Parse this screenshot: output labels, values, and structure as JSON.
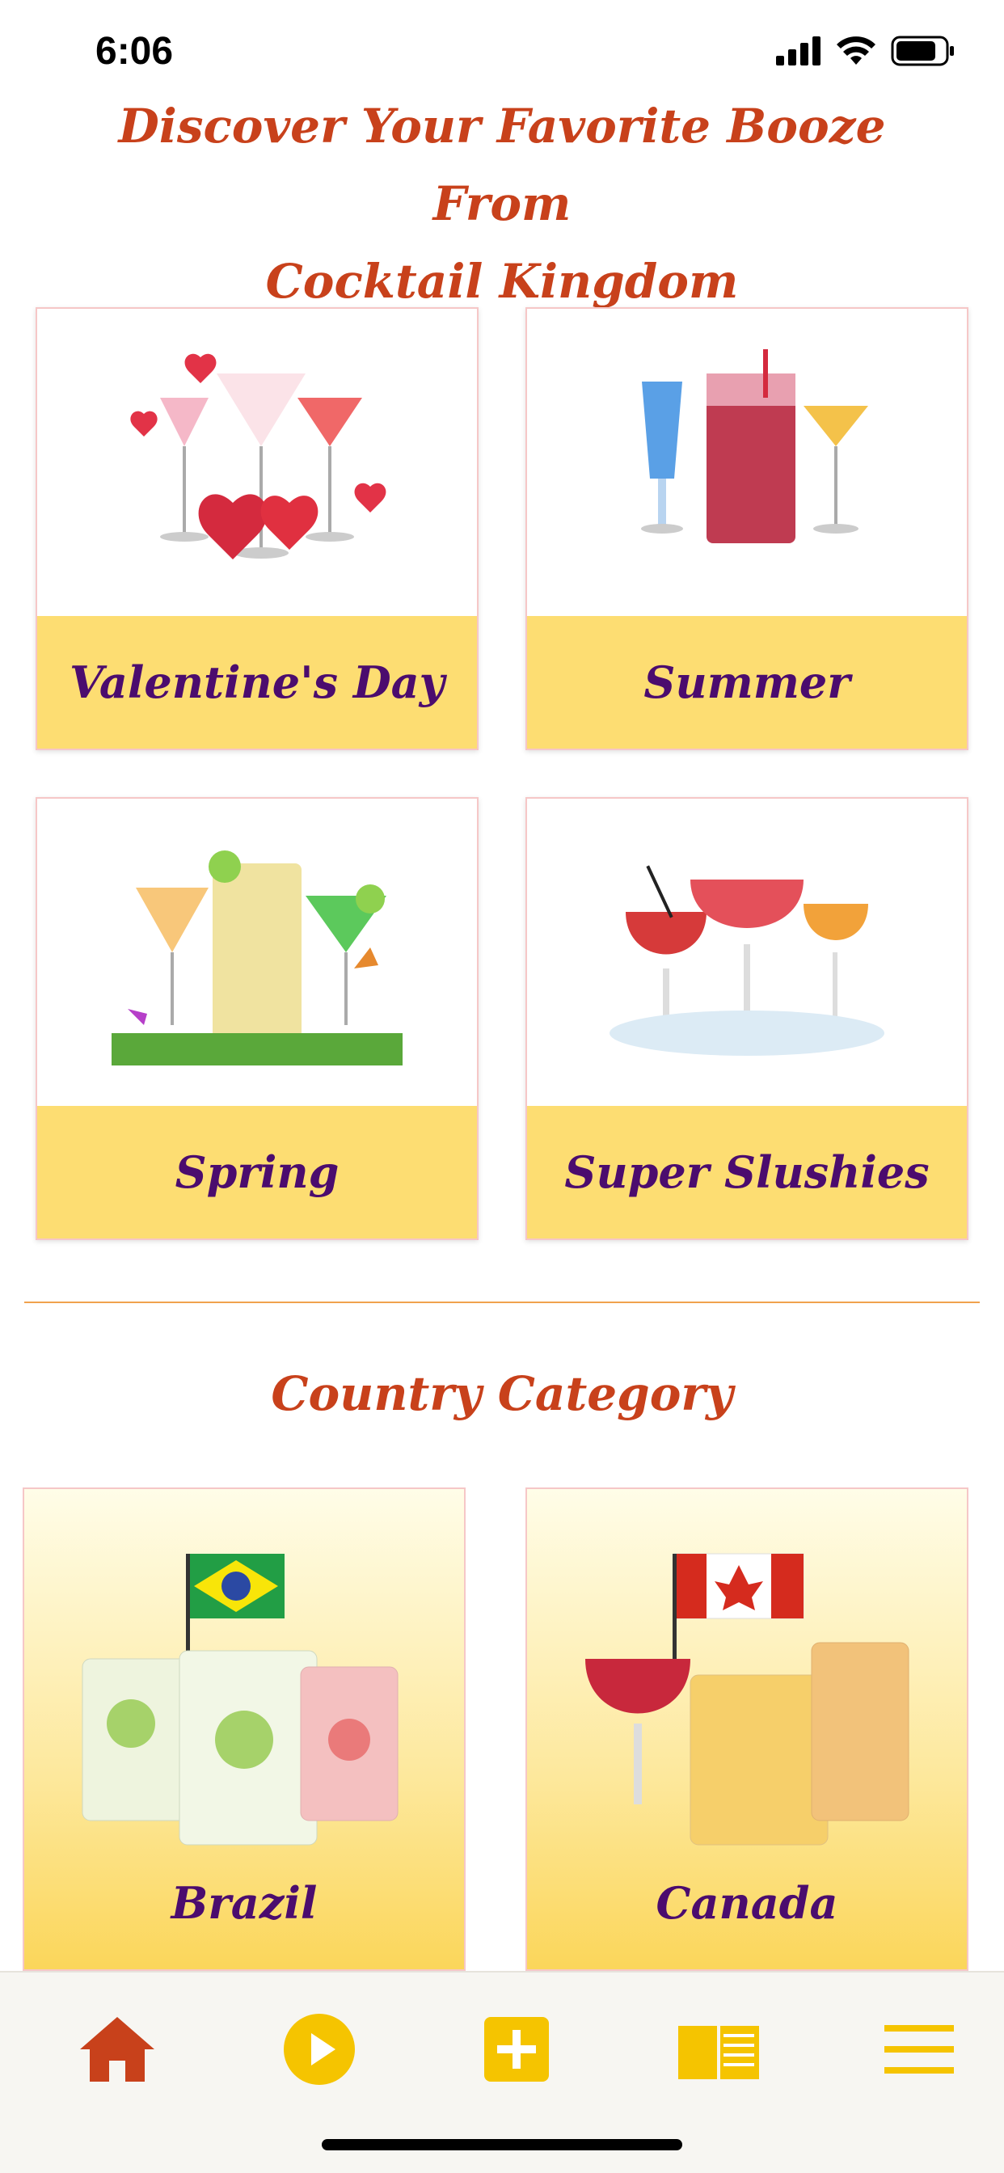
{
  "status_bar": {
    "time": "6:06"
  },
  "header": {
    "title_line1": "Discover Your Favorite Booze From",
    "title_line2": "Cocktail Kingdom"
  },
  "categories": [
    {
      "label": "Valentine's Day",
      "icon": "valentines-cocktails-image"
    },
    {
      "label": "Summer",
      "icon": "summer-cocktails-image"
    },
    {
      "label": "Spring",
      "icon": "spring-cocktails-image"
    },
    {
      "label": "Super Slushies",
      "icon": "slushies-cocktails-image"
    }
  ],
  "country_section": {
    "title": "Country Category",
    "items": [
      {
        "label": "Brazil",
        "icon": "brazil-cocktails-image"
      },
      {
        "label": "Canada",
        "icon": "canada-cocktails-image"
      }
    ]
  },
  "tab_bar": {
    "items": [
      {
        "icon": "home-icon",
        "color": "#c8411b"
      },
      {
        "icon": "play-icon",
        "color": "#f5c400"
      },
      {
        "icon": "add-icon",
        "color": "#f5c400"
      },
      {
        "icon": "book-icon",
        "color": "#f5c400"
      },
      {
        "icon": "menu-icon",
        "color": "#f5c400"
      }
    ]
  },
  "colors": {
    "title": "#c8411b",
    "label": "#4b0c6e",
    "label_bg": "#fddd72",
    "divider": "#f0a24d"
  }
}
